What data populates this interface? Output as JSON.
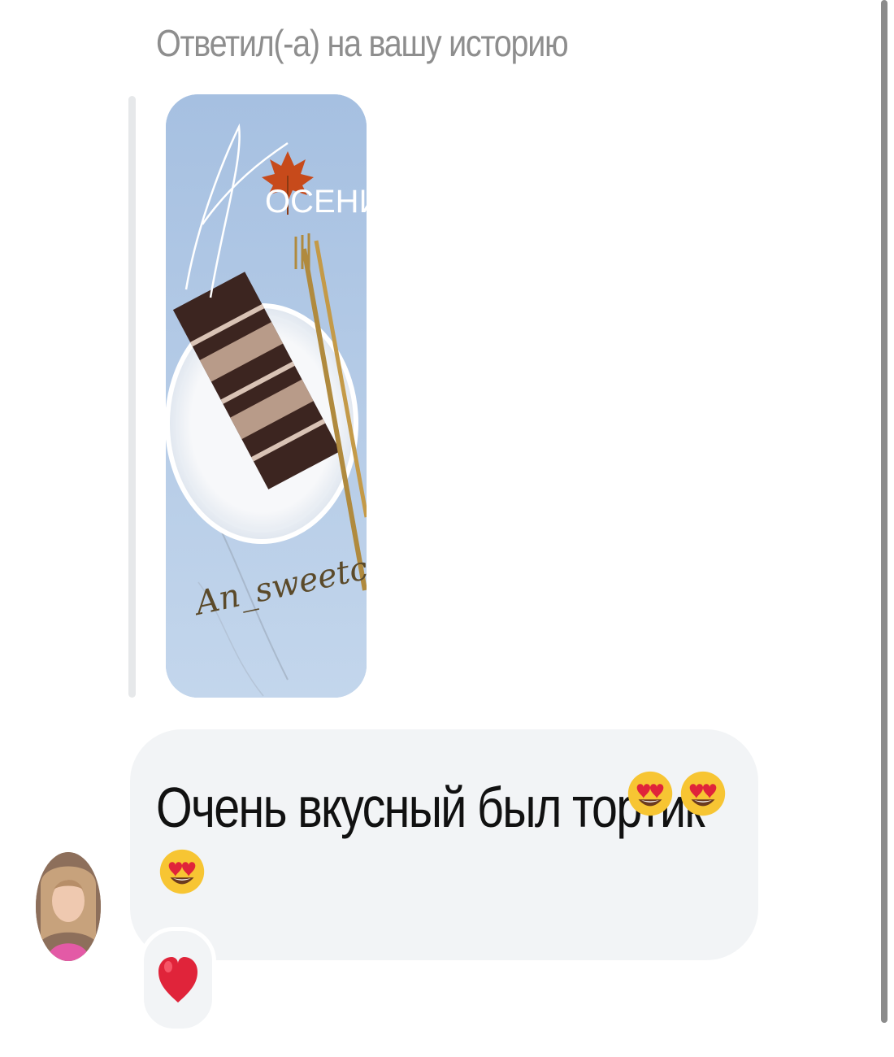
{
  "thread": {
    "reply_caption": "Ответил(-а) на вашу историю",
    "story": {
      "overlay_title_script": "Утро",
      "overlay_title": "ОСЕНИ",
      "watermark": "An_sweetcake"
    },
    "message": {
      "text": "Очень вкусный был тортик",
      "emojis": [
        "heart-eyes-emoji",
        "heart-eyes-emoji",
        "heart-eyes-emoji"
      ]
    },
    "reaction": {
      "icon": "red-heart-icon"
    }
  },
  "colors": {
    "caption_gray": "#8e8e8e",
    "bubble_background": "#f2f4f6",
    "story_background": "#a9c3e3",
    "heart_red": "#e0243a",
    "emoji_yellow": "#f7c533"
  }
}
